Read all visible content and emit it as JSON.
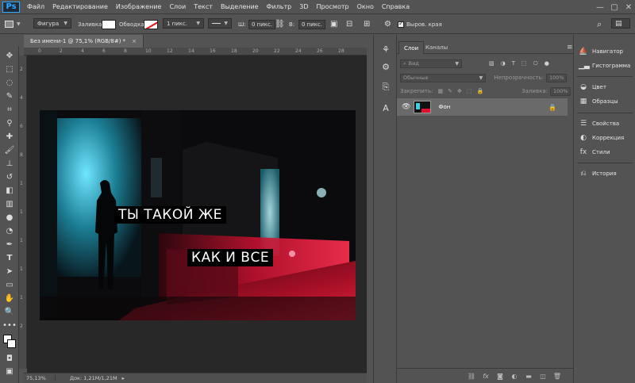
{
  "app": {
    "logo": "Ps"
  },
  "menu": [
    "Файл",
    "Редактирование",
    "Изображение",
    "Слои",
    "Текст",
    "Выделение",
    "Фильтр",
    "3D",
    "Просмотр",
    "Окно",
    "Справка"
  ],
  "window_controls": [
    "—",
    "▢",
    "✕"
  ],
  "options": {
    "mode": "Фигура",
    "fill_label": "Заливка:",
    "stroke_label": "Обводка:",
    "stroke_width": "1 пикс.",
    "w_label": "Ш:",
    "w_value": "0 пикс.",
    "link_icon": "link-icon",
    "h_label": "В:",
    "h_value": "0 пикс.",
    "align_edges": "Выров. края"
  },
  "document": {
    "tab_title": "Без имени-1 @ 75,1% (RGB/8#) *",
    "tab_close": "×",
    "caption_top": "ТЫ ТАКОЙ ЖЕ",
    "caption_bottom": "КАК И ВСЕ"
  },
  "rulers": {
    "top": [
      "0",
      "2",
      "4",
      "6",
      "8",
      "10",
      "12",
      "14",
      "16",
      "18",
      "20",
      "22",
      "24",
      "26",
      "28"
    ],
    "left": [
      "2",
      "4",
      "6",
      "8",
      "1",
      "1",
      "1",
      "1",
      "1",
      "2"
    ]
  },
  "status": {
    "zoom": "75,13%",
    "doc": "Док: 1,21М/1,21М"
  },
  "layers_panel": {
    "tabs": [
      "Слои",
      "Каналы"
    ],
    "menu_icon": "≡",
    "kind_label": "Вид",
    "blend_mode": "Обычные",
    "opacity_label": "Непрозрачность:",
    "opacity_value": "100%",
    "lock_label": "Закрепить:",
    "fill_label": "Заливка:",
    "fill_value": "100%",
    "layer_name": "Фон"
  },
  "dock": {
    "items": [
      {
        "label": "Навигатор",
        "icon": "navigator-icon"
      },
      {
        "label": "Гистограмма",
        "icon": "histogram-icon"
      },
      {
        "label": "Цвет",
        "icon": "color-icon"
      },
      {
        "label": "Образцы",
        "icon": "swatches-icon"
      },
      {
        "label": "Свойства",
        "icon": "properties-icon"
      },
      {
        "label": "Коррекция",
        "icon": "adjustments-icon"
      },
      {
        "label": "Стили",
        "icon": "styles-icon"
      },
      {
        "label": "История",
        "icon": "history-icon"
      }
    ]
  },
  "colors": {
    "ui_bg": "#535353",
    "panel_border": "#3a3a3a",
    "accent_blue": "#31a8ff",
    "neon_red": "#e01030",
    "neon_cyan": "#3ad0e8"
  }
}
